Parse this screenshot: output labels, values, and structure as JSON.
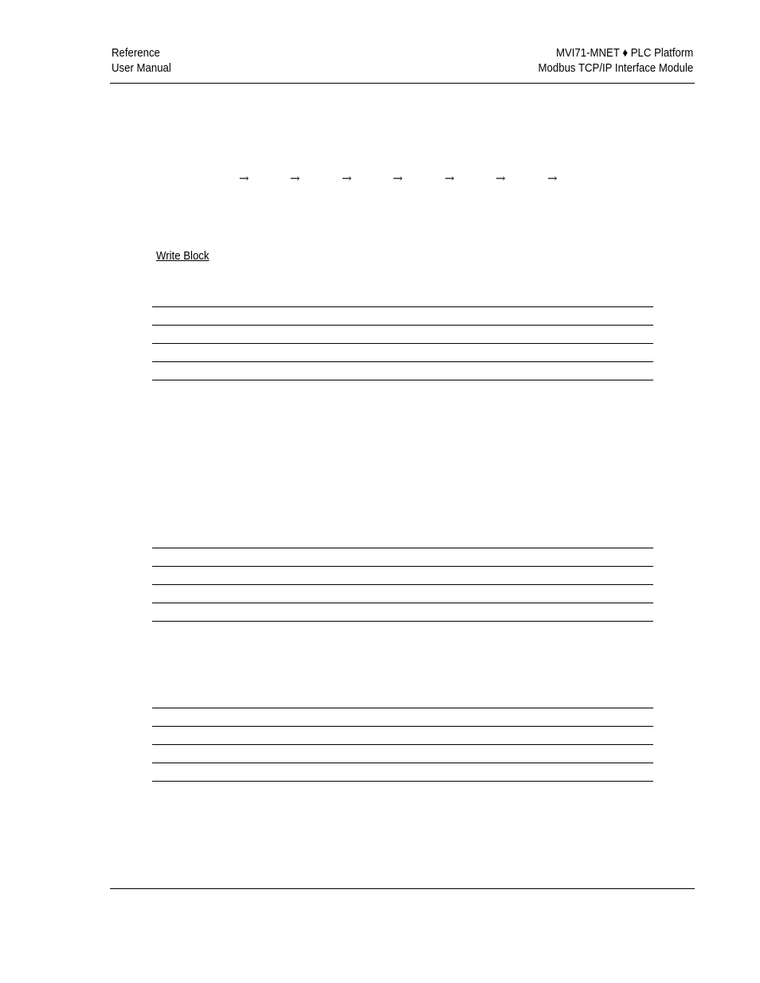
{
  "header": {
    "left": [
      "Reference",
      "User Manual"
    ],
    "right": [
      "MVI71-MNET ♦ PLC Platform",
      "Modbus TCP/IP Interface Module"
    ]
  },
  "flow": {
    "arrows": [
      "→",
      "→",
      "→",
      "→",
      "→",
      "→",
      "→"
    ]
  },
  "section": {
    "heading": "Write Block"
  },
  "tables": [
    {
      "rows": [
        "",
        "",
        "",
        ""
      ]
    },
    {
      "rows": [
        "",
        "",
        "",
        ""
      ]
    },
    {
      "rows": [
        "",
        "",
        "",
        ""
      ]
    }
  ]
}
